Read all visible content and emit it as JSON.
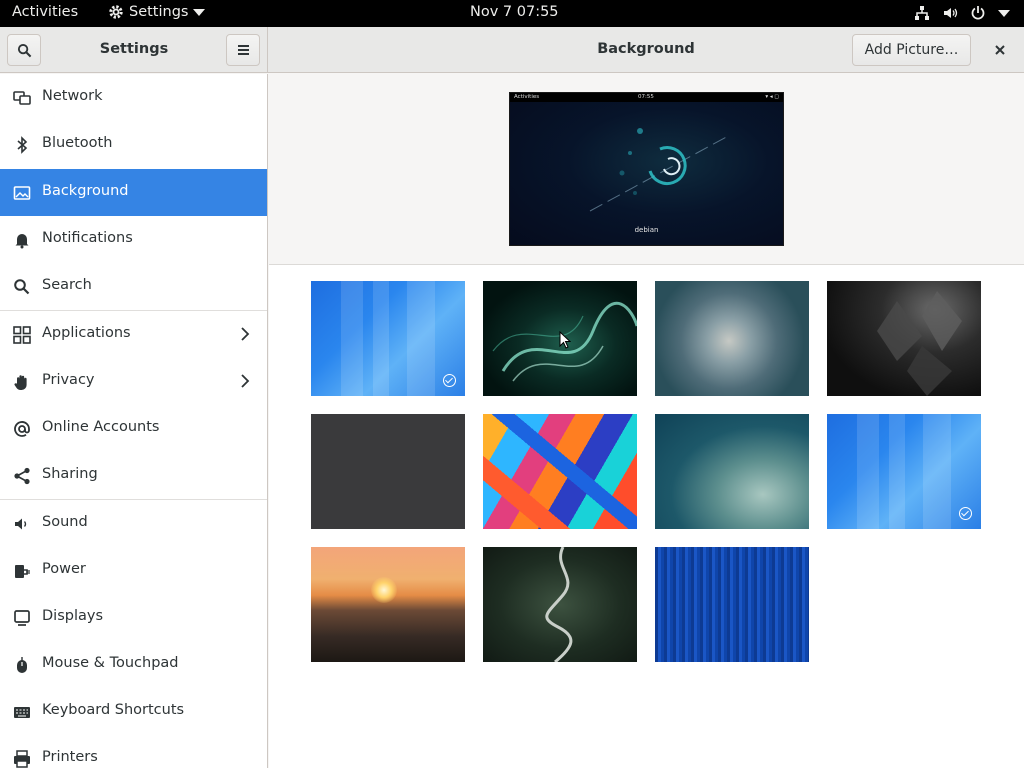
{
  "topbar": {
    "activities": "Activities",
    "app_menu": "Settings",
    "clock": "Nov 7  07:55",
    "tray_icons": [
      "network-wired-icon",
      "volume-icon",
      "power-icon"
    ]
  },
  "headerbar": {
    "left_title": "Settings",
    "main_title": "Background",
    "add_picture": "Add Picture…",
    "search_icon": "search-icon",
    "menu_icon": "hamburger-menu-icon",
    "close_icon": "close-icon"
  },
  "sidebar": {
    "items": [
      {
        "label": "Network",
        "icon": "network-icon"
      },
      {
        "label": "Bluetooth",
        "icon": "bluetooth-icon"
      },
      {
        "label": "Background",
        "icon": "background-icon",
        "selected": true
      },
      {
        "label": "Notifications",
        "icon": "bell-icon"
      },
      {
        "label": "Search",
        "icon": "search-icon"
      },
      {
        "label": "Applications",
        "icon": "applications-grid-icon",
        "chevron": true
      },
      {
        "label": "Privacy",
        "icon": "hand-icon",
        "chevron": true
      },
      {
        "label": "Online Accounts",
        "icon": "at-sign-icon"
      },
      {
        "label": "Sharing",
        "icon": "share-icon"
      },
      {
        "label": "Sound",
        "icon": "speaker-icon"
      },
      {
        "label": "Power",
        "icon": "power-plug-icon"
      },
      {
        "label": "Displays",
        "icon": "display-icon"
      },
      {
        "label": "Mouse & Touchpad",
        "icon": "mouse-icon"
      },
      {
        "label": "Keyboard Shortcuts",
        "icon": "keyboard-icon"
      },
      {
        "label": "Printers",
        "icon": "printer-icon"
      }
    ]
  },
  "preview": {
    "activities": "Activities",
    "clock": "07:55",
    "label": "debian"
  },
  "wallpapers": [
    {
      "name": "blue-geometric",
      "selected": true
    },
    {
      "name": "green-smoke"
    },
    {
      "name": "forest-treetops"
    },
    {
      "name": "dark-leaves"
    },
    {
      "name": "dark-gray"
    },
    {
      "name": "colorful-painting"
    },
    {
      "name": "aerial-teal"
    },
    {
      "name": "blue-geometric-2",
      "selected": true
    },
    {
      "name": "ocean-sunset"
    },
    {
      "name": "winding-road-forest"
    },
    {
      "name": "blue-lines"
    }
  ],
  "colors": {
    "accent": "#3584e4",
    "topbar": "#000000",
    "headerbar": "#e8e8e7"
  }
}
